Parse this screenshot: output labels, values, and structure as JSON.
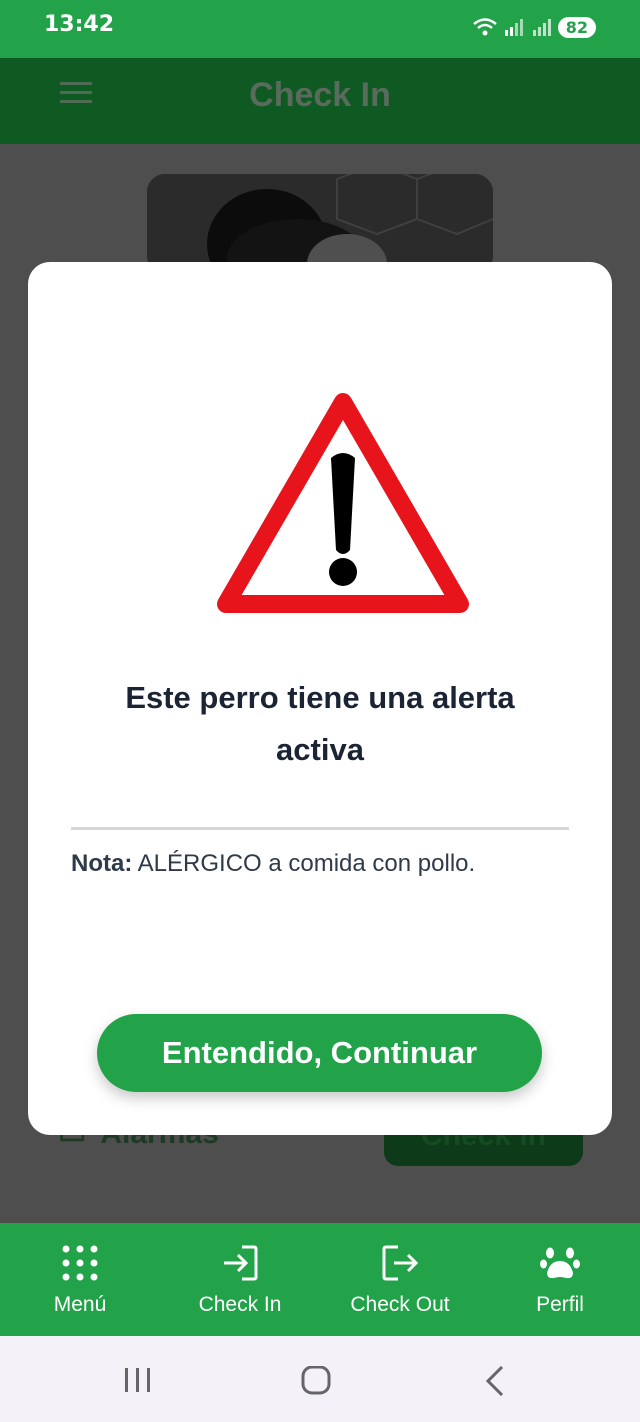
{
  "status_bar": {
    "time": "13:42",
    "battery": "82"
  },
  "app_bar": {
    "title": "Check In",
    "menu_icon": "hamburger-icon"
  },
  "background": {
    "alarms_label": "Alarmas",
    "checkin_button": "Check In"
  },
  "modal": {
    "icon": "warning-triangle-icon",
    "title": "Este perro tiene una alerta activa",
    "note_label": "Nota:",
    "note_text": " ALÉRGICO a comida con pollo.",
    "confirm_button": "Entendido, Continuar"
  },
  "bottom_nav": {
    "items": [
      {
        "label": "Menú",
        "icon": "grid-dots-icon"
      },
      {
        "label": "Check In",
        "icon": "sign-in-icon"
      },
      {
        "label": "Check Out",
        "icon": "sign-out-icon"
      },
      {
        "label": "Perfil",
        "icon": "paw-icon"
      }
    ]
  },
  "colors": {
    "primary": "#22a34a",
    "dark_green": "#0f5a22",
    "warning_red": "#e8141c"
  }
}
